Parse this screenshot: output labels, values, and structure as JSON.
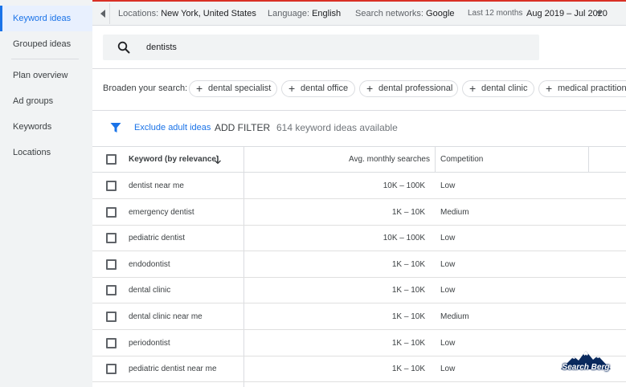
{
  "sidebar": {
    "items": [
      {
        "label": "Keyword ideas",
        "active": true
      },
      {
        "label": "Grouped ideas",
        "active": false
      },
      {
        "label": "Plan overview",
        "active": false
      },
      {
        "label": "Ad groups",
        "active": false
      },
      {
        "label": "Keywords",
        "active": false
      },
      {
        "label": "Locations",
        "active": false
      }
    ]
  },
  "topbar": {
    "locations_label": "Locations:",
    "locations_value": "New York, United States",
    "language_label": "Language:",
    "language_value": "English",
    "networks_label": "Search networks:",
    "networks_value": "Google",
    "period_label": "Last 12 months",
    "period_value": "Aug 2019 – Jul 2020"
  },
  "search": {
    "query": "dentists"
  },
  "broaden": {
    "label": "Broaden your search:",
    "chips": [
      "dental specialist",
      "dental office",
      "dental professional",
      "dental clinic",
      "medical practitioner"
    ]
  },
  "filters": {
    "exclude_label": "Exclude adult ideas",
    "add_filter_label": "ADD FILTER",
    "ideas_count": "614 keyword ideas available"
  },
  "table": {
    "headers": {
      "keyword": "Keyword (by relevance)",
      "searches": "Avg. monthly searches",
      "competition": "Competition"
    },
    "rows": [
      {
        "keyword": "dentist near me",
        "searches": "10K – 100K",
        "competition": "Low"
      },
      {
        "keyword": "emergency dentist",
        "searches": "1K – 10K",
        "competition": "Medium"
      },
      {
        "keyword": "pediatric dentist",
        "searches": "10K – 100K",
        "competition": "Low"
      },
      {
        "keyword": "endodontist",
        "searches": "1K – 10K",
        "competition": "Low"
      },
      {
        "keyword": "dental clinic",
        "searches": "1K – 10K",
        "competition": "Low"
      },
      {
        "keyword": "dental clinic near me",
        "searches": "1K – 10K",
        "competition": "Medium"
      },
      {
        "keyword": "periodontist",
        "searches": "1K – 10K",
        "competition": "Low"
      },
      {
        "keyword": "pediatric dentist near me",
        "searches": "1K – 10K",
        "competition": "Low"
      }
    ]
  },
  "watermark": {
    "text": "Search Berg"
  },
  "colors": {
    "accent": "#1a73e8",
    "sidebar_bg": "#f1f3f4",
    "active_bg": "#e8f0fe",
    "top_border": "#d93025"
  },
  "icons": {
    "collapse": "triangle-left-icon",
    "search": "search-icon",
    "chip": "plus-icon",
    "filter": "filter-funnel-icon",
    "sort": "arrow-down-icon",
    "dropdown": "caret-down-icon"
  }
}
